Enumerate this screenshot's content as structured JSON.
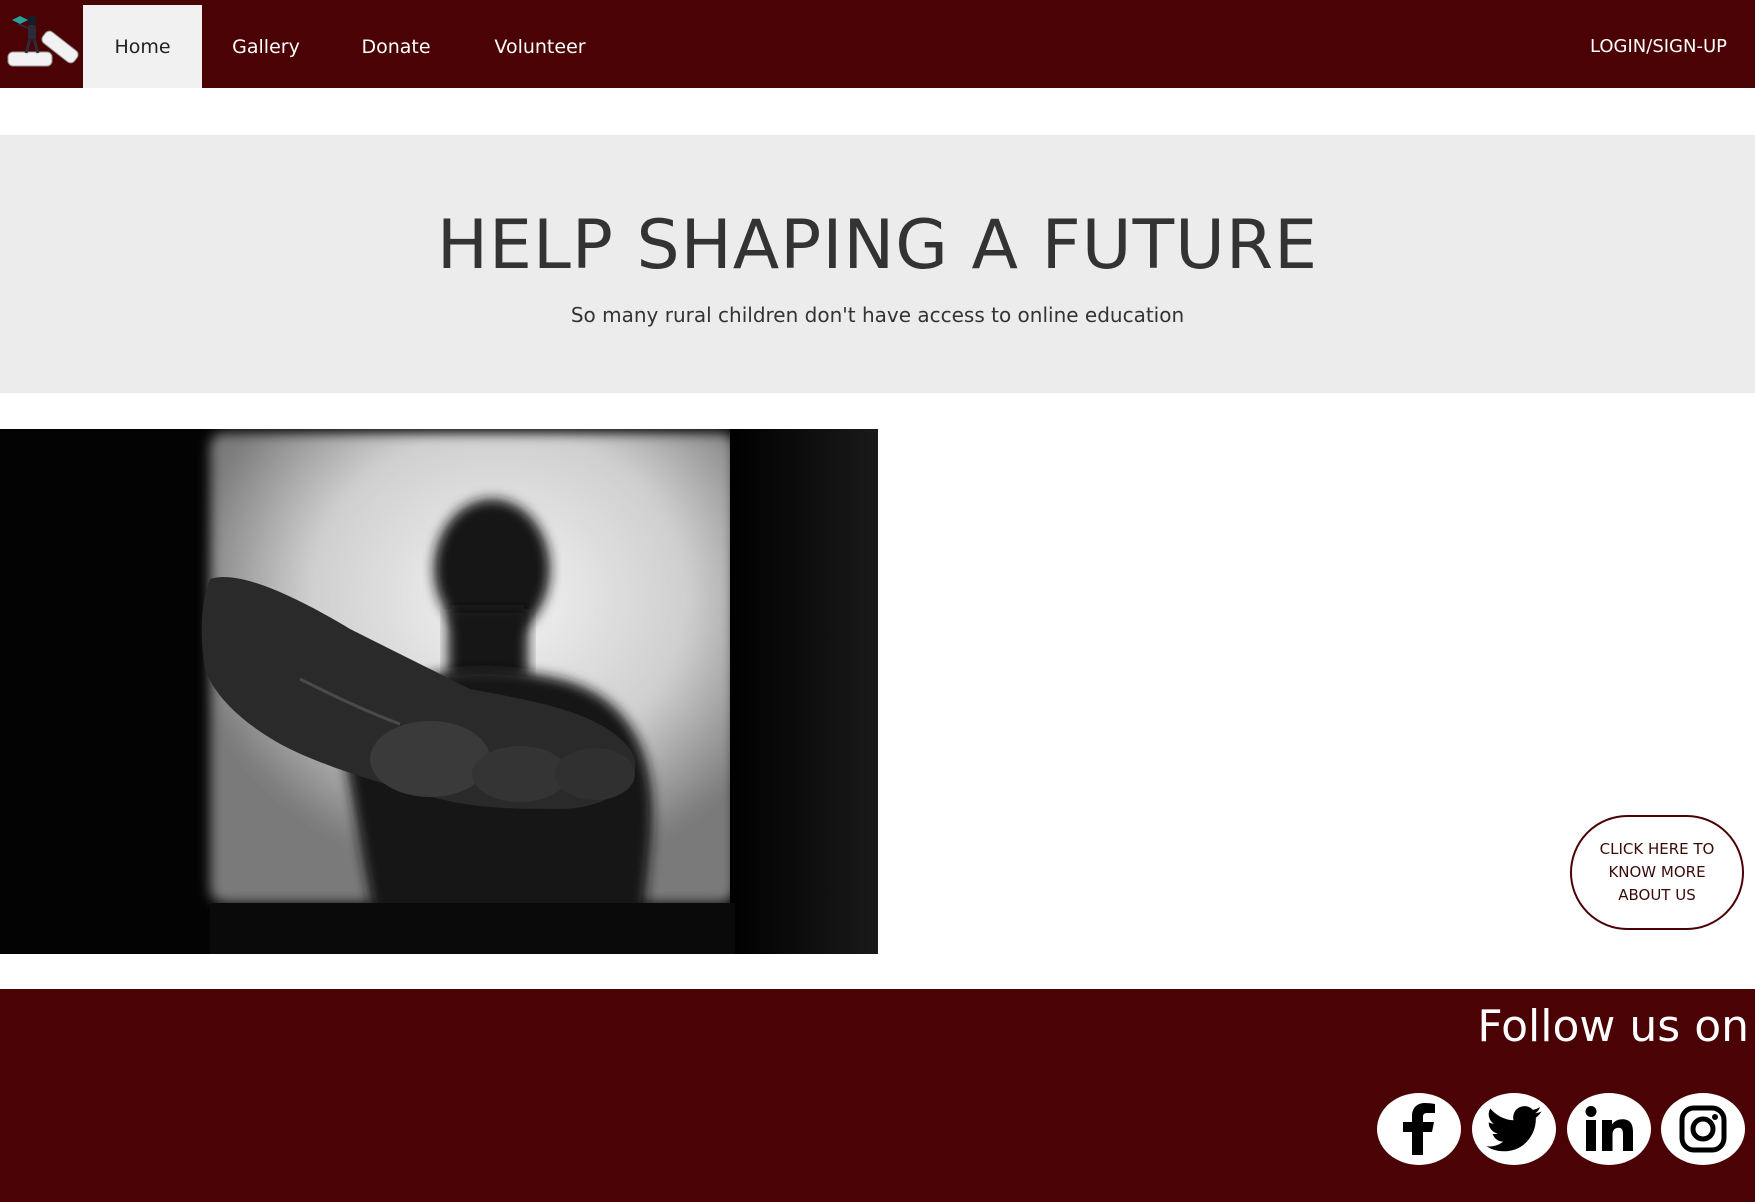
{
  "nav": {
    "items": [
      {
        "label": "Home",
        "active": true
      },
      {
        "label": "Gallery"
      },
      {
        "label": "Donate"
      },
      {
        "label": "Volunteer"
      }
    ],
    "login_label": "LOGIN/SIGN-UP",
    "logo_icon": "book-graduate-logo-icon"
  },
  "hero": {
    "title": "HELP SHAPING A FUTURE",
    "subtitle": "So many rural children don't have access to online education"
  },
  "about_button": {
    "label": "CLICK HERE TO KNOW MORE ABOUT US"
  },
  "footer": {
    "follow_label": "Follow us on",
    "social": [
      "facebook-icon",
      "twitter-icon",
      "linkedin-icon",
      "instagram-icon"
    ]
  },
  "colors": {
    "brand": "#4a0205",
    "hero_bg": "#ececec",
    "active_tab_bg": "#f1f1f1"
  }
}
